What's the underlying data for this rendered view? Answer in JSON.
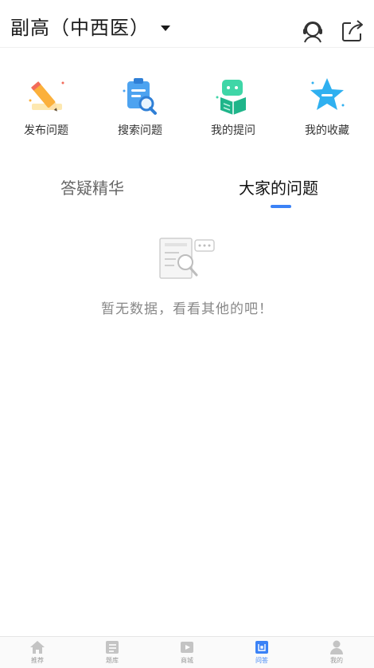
{
  "header": {
    "title": "副高（中西医）",
    "support_icon": "headset-support-icon",
    "share_icon": "share-icon"
  },
  "quick_actions": [
    {
      "label": "发布问题",
      "icon": "pencil-icon"
    },
    {
      "label": "搜索问题",
      "icon": "search-clipboard-icon"
    },
    {
      "label": "我的提问",
      "icon": "question-book-icon"
    },
    {
      "label": "我的收藏",
      "icon": "star-icon"
    }
  ],
  "tabs": [
    {
      "label": "答疑精华",
      "active": false
    },
    {
      "label": "大家的问题",
      "active": true
    }
  ],
  "empty_state": {
    "message": "暂无数据，看看其他的吧！",
    "icon": "empty-document-search-icon"
  },
  "bottom_nav": [
    {
      "label": "推荐",
      "icon": "home-icon",
      "active": false
    },
    {
      "label": "题库",
      "icon": "question-bank-icon",
      "active": false
    },
    {
      "label": "商城",
      "icon": "video-play-icon",
      "active": false
    },
    {
      "label": "问答",
      "icon": "qa-chat-icon",
      "active": true
    },
    {
      "label": "我的",
      "icon": "user-icon",
      "active": false
    }
  ],
  "colors": {
    "accent": "#3b82f6",
    "inactive_nav": "#bbbbbb",
    "text_muted": "#888888"
  }
}
